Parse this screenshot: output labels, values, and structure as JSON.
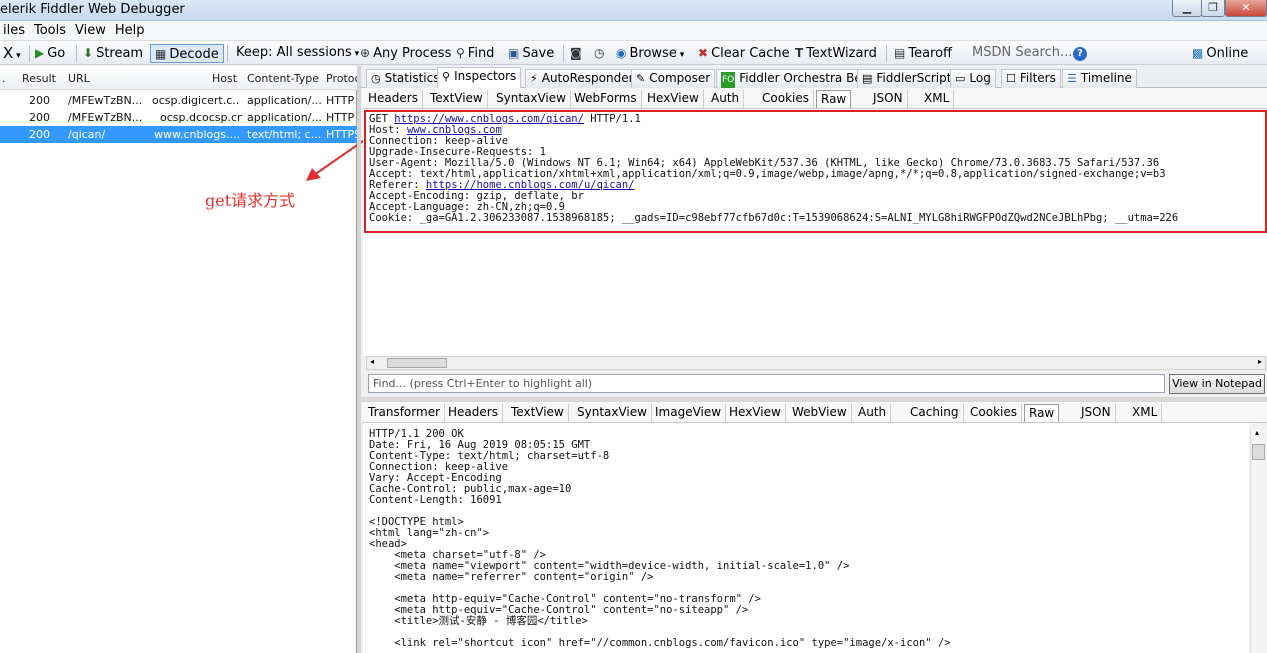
{
  "title": "elerik Fiddler Web Debugger",
  "menu": [
    "iles",
    "Tools",
    "View",
    "Help"
  ],
  "toolbar": {
    "x": "X",
    "go": "Go",
    "stream": "Stream",
    "decode": "Decode",
    "keep": "Keep: All sessions",
    "any": "Any Process",
    "find": "Find",
    "save": "Save",
    "browse": "Browse",
    "clear": "Clear Cache",
    "textwizard": "TextWizard",
    "tearoff": "Tearoff",
    "msdn": "MSDN Search...",
    "online": "Online"
  },
  "sessions": {
    "headers": [
      ".",
      "Result",
      "URL",
      "Host",
      "Content-Type",
      "Protoc"
    ],
    "rows": [
      {
        "result": "200",
        "url": "/MFEwTzBN...",
        "host": "ocsp.digicert.c...",
        "ctype": "application/...",
        "proto": "HTTP"
      },
      {
        "result": "200",
        "url": "/MFEwTzBN...",
        "host": "ocsp.dcocsp.cn",
        "ctype": "application/...",
        "proto": "HTTP"
      },
      {
        "result": "200",
        "url": "/qican/",
        "host": "www.cnblogs....",
        "ctype": "text/html; c...",
        "proto": "HTTPS"
      }
    ]
  },
  "annotation": "get请求方式",
  "tabs": [
    "Statistics",
    "Inspectors",
    "AutoResponder",
    "Composer",
    "Fiddler Orchestra Beta",
    "FiddlerScript",
    "Log",
    "Filters",
    "Timeline"
  ],
  "req_tabs": [
    "Headers",
    "TextView",
    "SyntaxView",
    "WebForms",
    "HexView",
    "Auth",
    "Cookies",
    "Raw",
    "JSON",
    "XML"
  ],
  "request": {
    "method": "GET ",
    "url": "https://www.cnblogs.com/qican/",
    "ver": " HTTP/1.1",
    "host_label": "Host: ",
    "host": "www.cnblogs.com",
    "l3": "Connection: keep-alive",
    "l4": "Upgrade-Insecure-Requests: 1",
    "l5": "User-Agent: Mozilla/5.0 (Windows NT 6.1; Win64; x64) AppleWebKit/537.36 (KHTML, like Gecko) Chrome/73.0.3683.75 Safari/537.36",
    "l6": "Accept: text/html,application/xhtml+xml,application/xml;q=0.9,image/webp,image/apng,*/*;q=0.8,application/signed-exchange;v=b3",
    "ref_label": "Referer: ",
    "ref": "https://home.cnblogs.com/u/qican/",
    "l8": "Accept-Encoding: gzip, deflate, br",
    "l9": "Accept-Language: zh-CN,zh;q=0.9",
    "l10": "Cookie: _ga=GA1.2.306233087.1538968185; __gads=ID=c98ebf77cfb67d0c:T=1539068624:S=ALNI_MYLG8hiRWGFPOdZQwd2NCeJBLhPbg; __utma=226"
  },
  "find_placeholder": "Find... (press Ctrl+Enter to highlight all)",
  "view_notepad": "View in Notepad",
  "resp_tabs": [
    "Transformer",
    "Headers",
    "TextView",
    "SyntaxView",
    "ImageView",
    "HexView",
    "WebView",
    "Auth",
    "Caching",
    "Cookies",
    "Raw",
    "JSON",
    "XML"
  ],
  "response": [
    "HTTP/1.1 200 OK",
    "Date: Fri, 16 Aug 2019 08:05:15 GMT",
    "Content-Type: text/html; charset=utf-8",
    "Connection: keep-alive",
    "Vary: Accept-Encoding",
    "Cache-Control: public,max-age=10",
    "Content-Length: 16091",
    "",
    "<!DOCTYPE html>",
    "<html lang=\"zh-cn\">",
    "<head>",
    "    <meta charset=\"utf-8\" />",
    "    <meta name=\"viewport\" content=\"width=device-width, initial-scale=1.0\" />",
    "    <meta name=\"referrer\" content=\"origin\" />",
    "",
    "    <meta http-equiv=\"Cache-Control\" content=\"no-transform\" />",
    "    <meta http-equiv=\"Cache-Control\" content=\"no-siteapp\" />",
    "    <title>测试-安静 - 博客园</title>",
    "",
    "    <link rel=\"shortcut icon\" href=\"//common.cnblogs.com/favicon.ico\" type=\"image/x-icon\" />"
  ]
}
